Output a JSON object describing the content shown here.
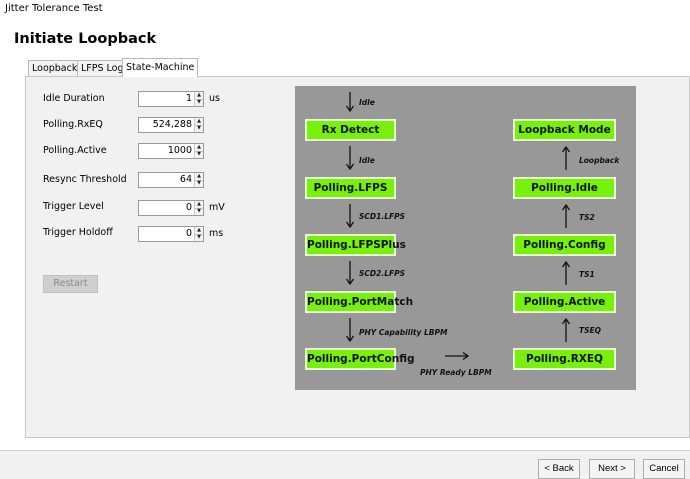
{
  "window": {
    "title": "Jitter Tolerance Test"
  },
  "page": {
    "heading": "Initiate Loopback"
  },
  "tabs": [
    {
      "label": "Loopback",
      "active": false
    },
    {
      "label": "LFPS Log",
      "active": false
    },
    {
      "label": "State-Machine",
      "active": true
    }
  ],
  "form": {
    "idle_duration": {
      "label": "Idle Duration",
      "value": "1",
      "unit": "us"
    },
    "polling_rxeq": {
      "label": "Polling.RxEQ",
      "value": "524,288"
    },
    "polling_active": {
      "label": "Polling.Active",
      "value": "1000"
    },
    "resync_threshold": {
      "label": "Resync Threshold",
      "value": "64"
    },
    "trigger_level": {
      "label": "Trigger Level",
      "value": "0",
      "unit": "mV"
    },
    "trigger_holdoff": {
      "label": "Trigger Holdoff",
      "value": "0",
      "unit": "ms"
    },
    "restart_label": "Restart",
    "restart_enabled": false
  },
  "diagram": {
    "colors": {
      "background": "#989898",
      "state_fill": "#77f00c",
      "state_border": "#e7ffd0"
    },
    "states": {
      "rx_detect": "Rx Detect",
      "polling_lfps": "Polling.LFPS",
      "polling_lfpsplus": "Polling.LFPSPlus",
      "polling_portmatch": "Polling.PortMatch",
      "polling_portconfig": "Polling.PortConfig",
      "loopback_mode": "Loopback Mode",
      "polling_idle": "Polling.Idle",
      "polling_config": "Polling.Config",
      "polling_active": "Polling.Active",
      "polling_rxeq": "Polling.RXEQ"
    },
    "transitions": {
      "entry": "Idle",
      "rx_to_lfps": "Idle",
      "lfps_to_lfpsplus": "SCD1.LFPS",
      "lfpsplus_to_portmatch": "SCD2.LFPS",
      "portmatch_to_portconfig": "PHY Capability LBPM",
      "portconfig_to_rxeq": "PHY Ready LBPM",
      "rxeq_to_active": "TSEQ",
      "active_to_config": "TS1",
      "config_to_idle": "TS2",
      "idle_to_loopback": "Loopback"
    }
  },
  "footer": {
    "back_label": "< Back",
    "next_label": "Next >",
    "cancel_label": "Cancel"
  }
}
